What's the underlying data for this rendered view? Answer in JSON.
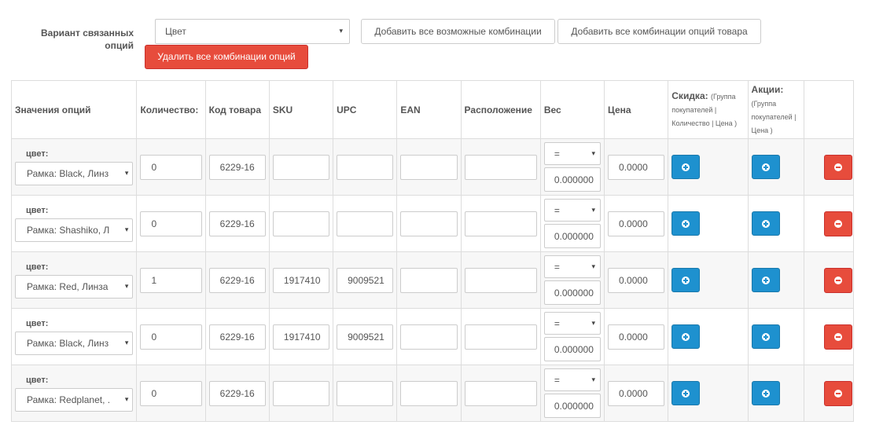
{
  "variant": {
    "label": "Вариант связанных опций",
    "selected": "Цвет"
  },
  "buttons": {
    "add_all_possible": "Добавить все возможные комбинации",
    "add_all_product": "Добавить все комбинации опций товара",
    "delete_all": "Удалить все комбинации опций"
  },
  "table": {
    "headers": {
      "option_values": "Значения опций",
      "quantity": "Количество:",
      "model": "Код товара",
      "sku": "SKU",
      "upc": "UPC",
      "ean": "EAN",
      "location": "Расположение",
      "weight": "Вес",
      "price": "Цена",
      "discount": "Скидка:",
      "discount_note": "(Группа покупателей | Количество | Цена )",
      "special": "Акции:",
      "special_note": "(Группа покупателей | Цена )"
    },
    "rows": [
      {
        "option_label": "цвет:",
        "option_value": "Рамка: Black, Линз",
        "quantity": "0",
        "model": "6229-16",
        "sku": "",
        "upc": "",
        "ean": "",
        "location": "",
        "weight_prefix": "=",
        "weight": "0.000000",
        "price": "0.0000"
      },
      {
        "option_label": "цвет:",
        "option_value": "Рамка: Shashiko, Л",
        "quantity": "0",
        "model": "6229-16",
        "sku": "",
        "upc": "",
        "ean": "",
        "location": "",
        "weight_prefix": "=",
        "weight": "0.000000",
        "price": "0.0000"
      },
      {
        "option_label": "цвет:",
        "option_value": "Рамка: Red, Линза",
        "quantity": "1",
        "model": "6229-16",
        "sku": "1917410",
        "upc": "9009521",
        "ean": "",
        "location": "",
        "weight_prefix": "=",
        "weight": "0.000000",
        "price": "0.0000"
      },
      {
        "option_label": "цвет:",
        "option_value": "Рамка: Black, Линз",
        "quantity": "0",
        "model": "6229-16",
        "sku": "1917410",
        "upc": "9009521",
        "ean": "",
        "location": "",
        "weight_prefix": "=",
        "weight": "0.000000",
        "price": "0.0000"
      },
      {
        "option_label": "цвет:",
        "option_value": "Рамка: Redplanet, .",
        "quantity": "0",
        "model": "6229-16",
        "sku": "",
        "upc": "",
        "ean": "",
        "location": "",
        "weight_prefix": "=",
        "weight": "0.000000",
        "price": "0.0000"
      }
    ]
  },
  "icons": {
    "caret": "▾",
    "add": "plus-circle-icon",
    "remove": "minus-circle-icon"
  },
  "colors": {
    "primary": "#1e91cf",
    "danger": "#e74c3c"
  }
}
